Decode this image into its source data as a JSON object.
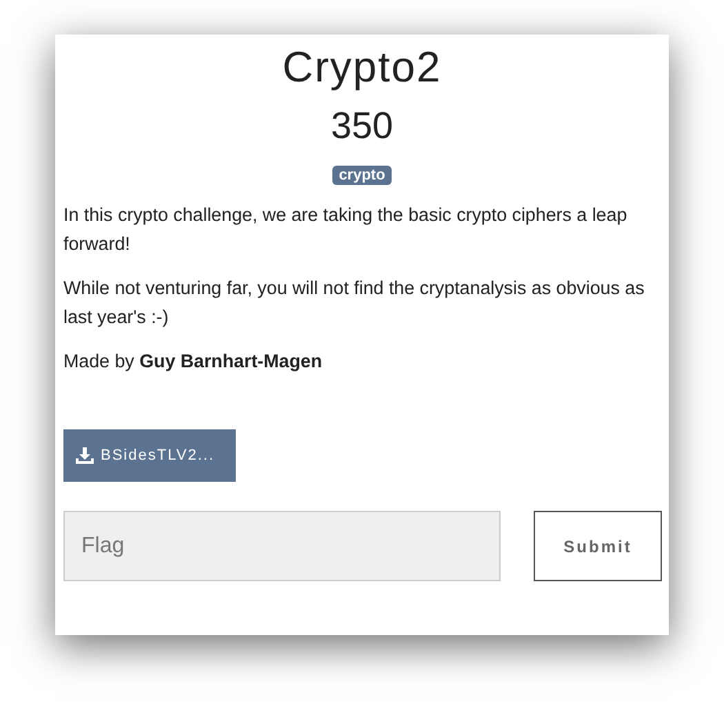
{
  "challenge": {
    "title": "Crypto2",
    "points": "350",
    "tags": [
      "crypto"
    ],
    "description": [
      "In this crypto challenge, we are taking the basic crypto ciphers a leap forward!",
      "While not venturing far, you will not find the cryptanalysis as obvious as last year's :-)",
      "Made by **Guy Barnhart-Magen**"
    ],
    "file": "BSidesTLV2...",
    "flag": {
      "placeholder": "Flag"
    },
    "submit": "Submit"
  }
}
